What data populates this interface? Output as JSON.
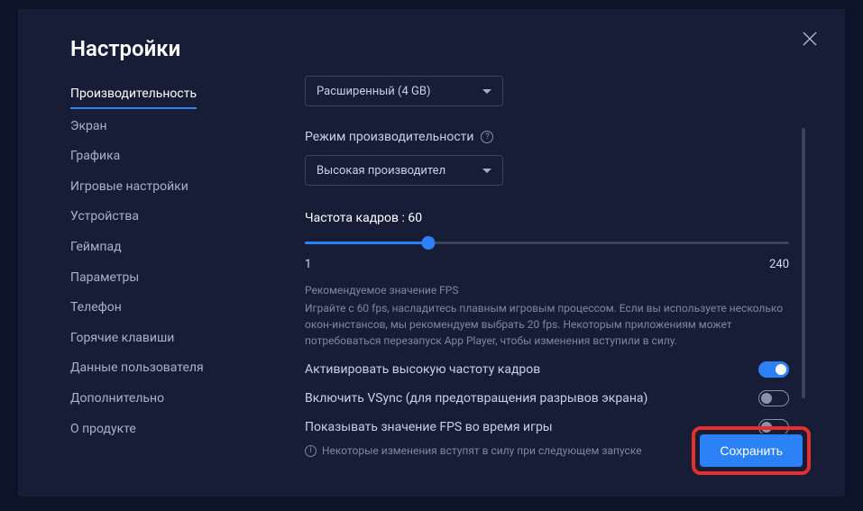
{
  "title": "Настройки",
  "sidebar": {
    "items": [
      {
        "label": "Производительность",
        "active": true
      },
      {
        "label": "Экран"
      },
      {
        "label": "Графика"
      },
      {
        "label": "Игровые настройки"
      },
      {
        "label": "Устройства"
      },
      {
        "label": "Геймпад"
      },
      {
        "label": "Параметры"
      },
      {
        "label": "Телефон"
      },
      {
        "label": "Горячие клавиши"
      },
      {
        "label": "Данные пользователя"
      },
      {
        "label": "Дополнительно"
      },
      {
        "label": "О продукте"
      }
    ]
  },
  "memory_select": "Расширенный (4 GB)",
  "perf_mode": {
    "label": "Режим производительности",
    "value": "Высокая производител"
  },
  "fps": {
    "label_prefix": "Частота кадров : ",
    "value": "60",
    "min": "1",
    "max": "240",
    "hint_title": "Рекомендуемое значение FPS",
    "hint_body": "Играйте с 60 fps, насладитесь плавным игровым процессом. Если вы используете несколько окон-инстансов, мы рекомендуем выбрать 20 fps. Некоторым приложениям может потребоваться перезапуск App Player, чтобы изменения вступили в силу."
  },
  "toggles": {
    "high_fps": {
      "label": "Активировать высокую частоту кадров",
      "on": true
    },
    "vsync": {
      "label": "Включить VSync (для предотвращения разрывов экрана)",
      "on": false
    },
    "show_fps": {
      "label": "Показывать значение FPS во время игры",
      "on": false
    }
  },
  "footer": {
    "note": "Некоторые изменения вступят в силу при следующем запуске",
    "save": "Сохранить"
  }
}
